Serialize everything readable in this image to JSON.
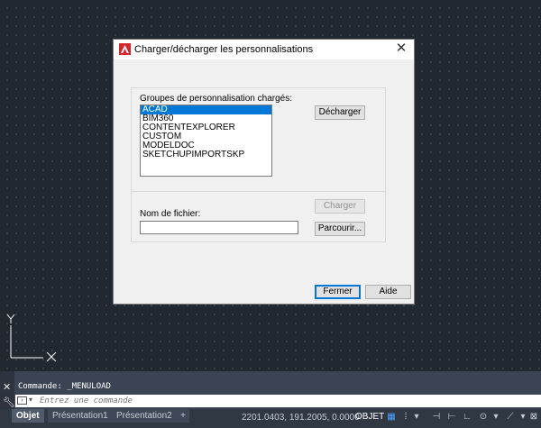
{
  "dialog": {
    "title": "Charger/décharger les personnalisations",
    "groups_label": "Groupes de personnalisation chargés:",
    "groups": [
      "ACAD",
      "BIM360",
      "CONTENTEXPLORER",
      "CUSTOM",
      "MODELDOC",
      "SKETCHUPIMPORTSKP"
    ],
    "selected_group": "ACAD",
    "unload_label": "Décharger",
    "load_label": "Charger",
    "filename_label": "Nom de fichier:",
    "filename_value": "",
    "browse_label": "Parcourir...",
    "close_label": "Fermer",
    "help_label": "Aide"
  },
  "ucs": {
    "y_label": "Y",
    "x_label": "X"
  },
  "command": {
    "history": "Commande:  _MENULOAD",
    "placeholder": "Entrez une commande"
  },
  "statusbar": {
    "tabs": [
      "Objet",
      "Présentation1",
      "Présentation2"
    ],
    "add_tab": "+",
    "coords": "2201.0403, 191.2005, 0.0000",
    "mode": "OBJET"
  },
  "colors": {
    "accent": "#0078d7",
    "canvas": "#212830",
    "logo_red": "#d8262c"
  }
}
